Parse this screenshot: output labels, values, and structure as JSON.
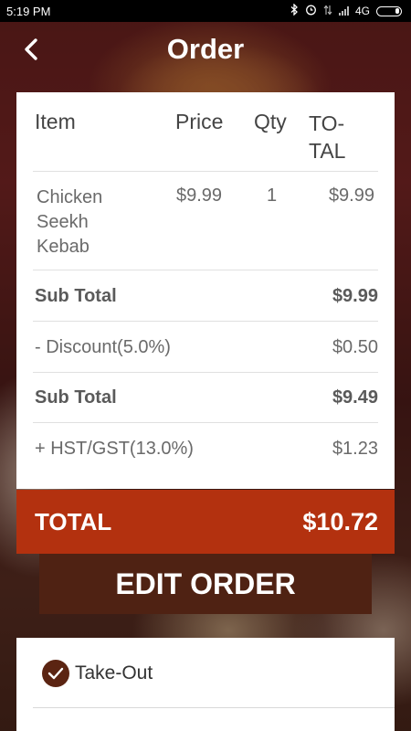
{
  "status_bar": {
    "time": "5:19 PM",
    "network": "4G"
  },
  "header": {
    "title": "Order"
  },
  "order_table": {
    "columns": {
      "item": "Item",
      "price": "Price",
      "qty": "Qty",
      "total": "TO-\nTAL"
    },
    "items": [
      {
        "name": "Chicken Seekh Kebab",
        "price": "$9.99",
        "qty": "1",
        "total": "$9.99"
      }
    ],
    "summary": [
      {
        "label": "Sub Total",
        "value": "$9.99"
      },
      {
        "label": "- Discount(5.0%)",
        "value": "$0.50"
      },
      {
        "label": "Sub Total",
        "value": "$9.49"
      },
      {
        "label": "+ HST/GST(13.0%)",
        "value": "$1.23"
      }
    ]
  },
  "total": {
    "label": "TOTAL",
    "value": "$10.72"
  },
  "actions": {
    "edit_order": "EDIT ORDER"
  },
  "order_type": {
    "takeout_label": "Take-Out",
    "takeout_checked": true
  },
  "colors": {
    "total_bar": "#b3310f",
    "edit_button": "#4f2213"
  }
}
